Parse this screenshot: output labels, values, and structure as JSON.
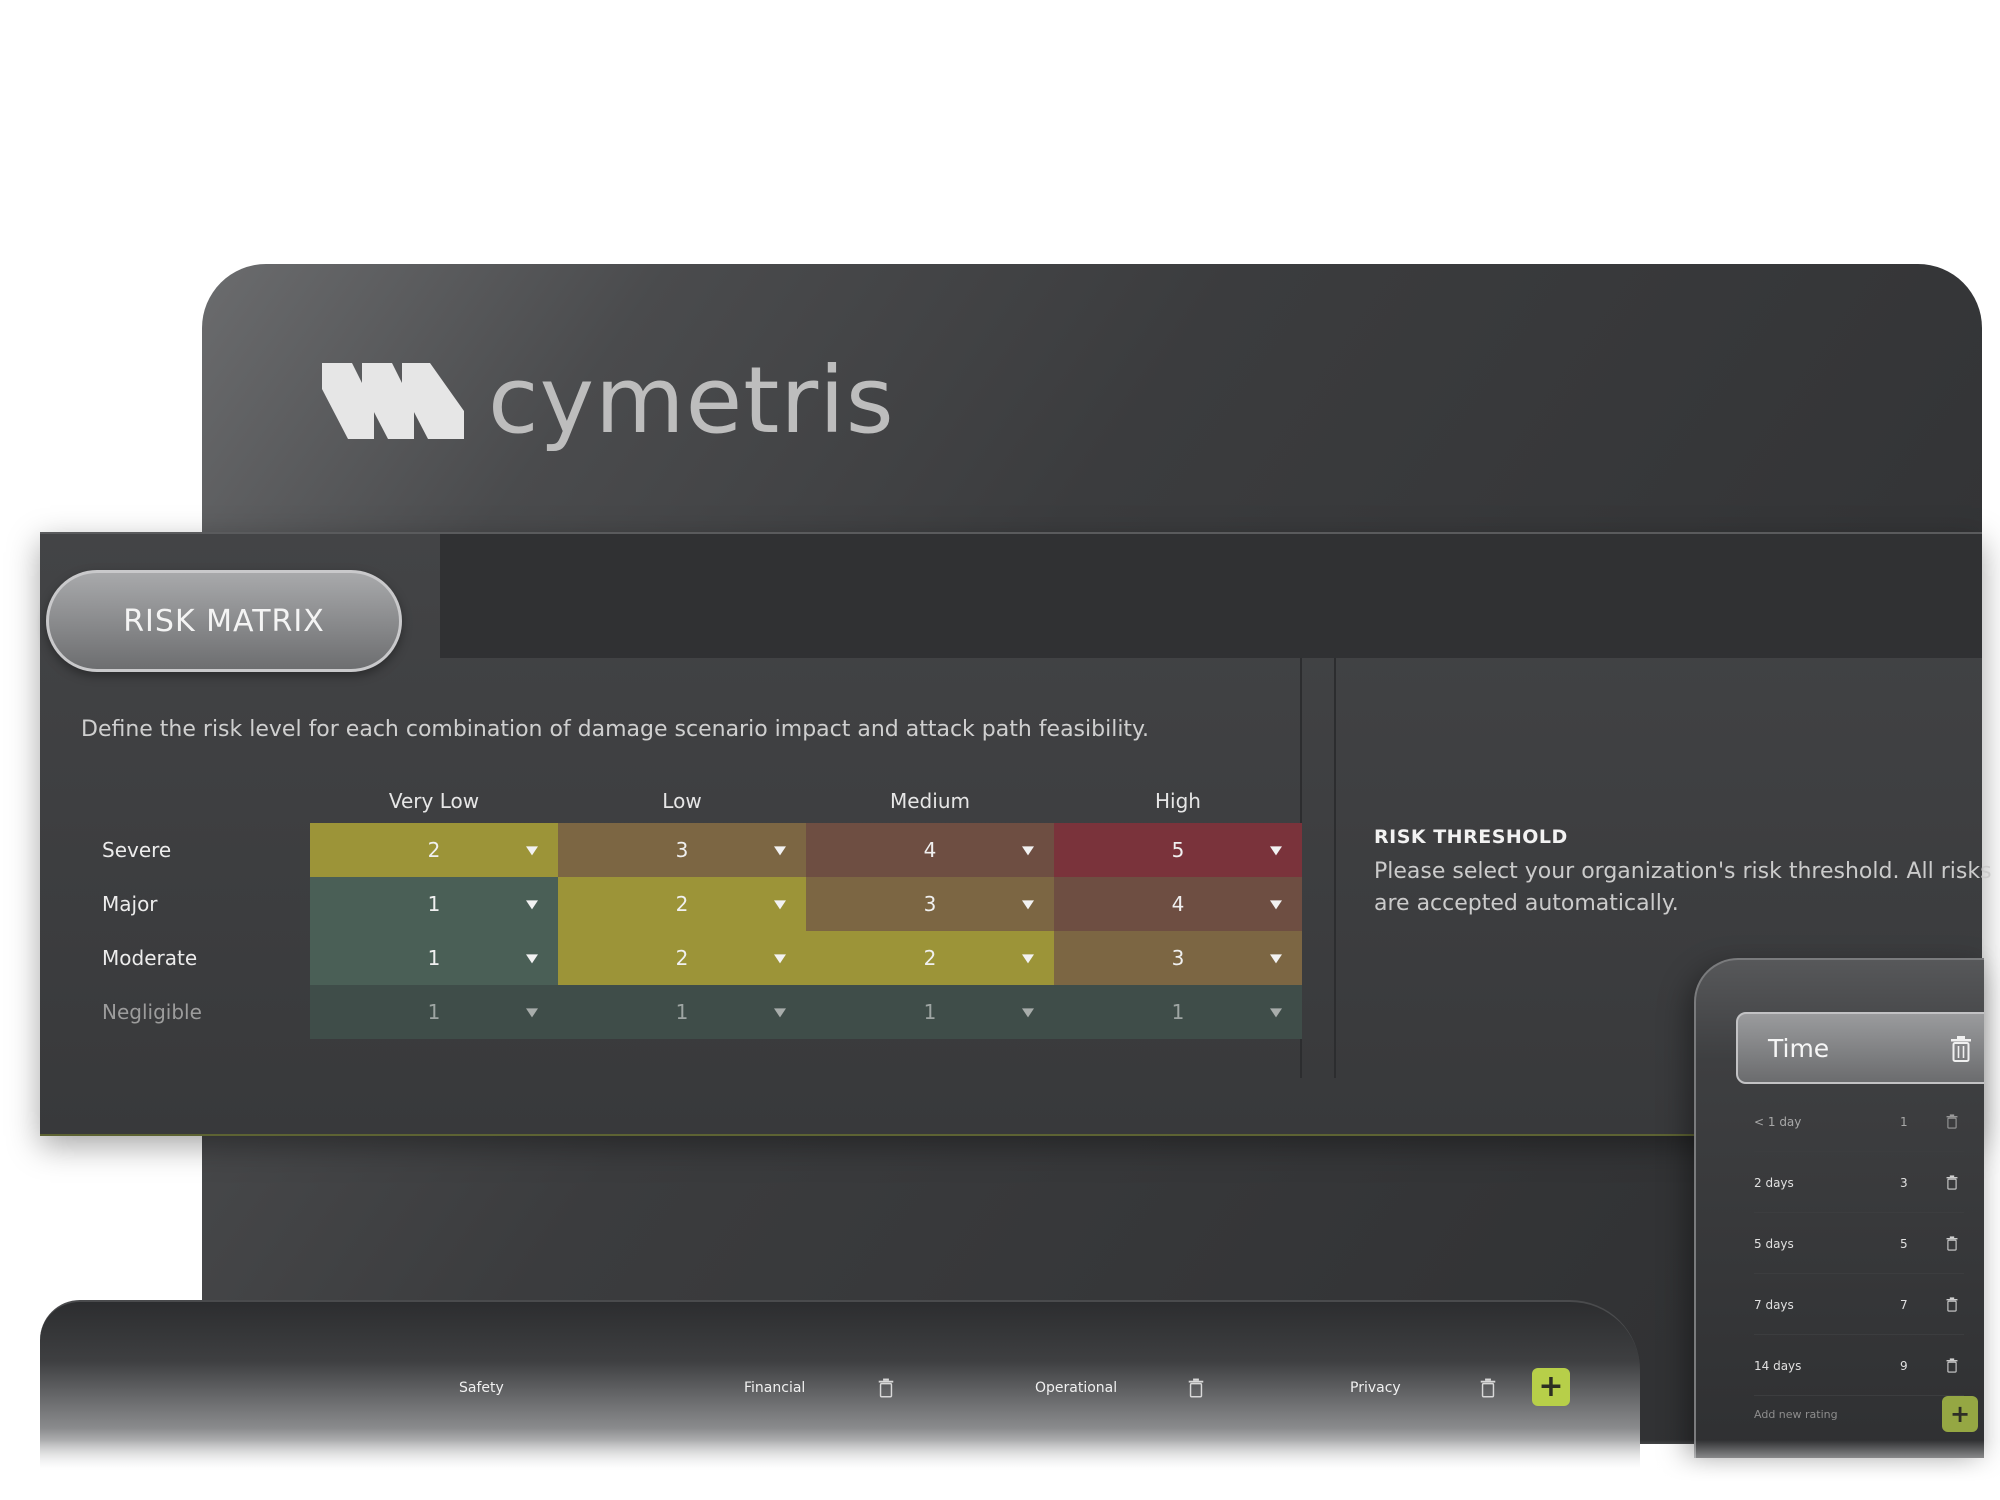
{
  "brand": {
    "name": "cymetris"
  },
  "matrix": {
    "title": "RISK MATRIX",
    "description": "Define the risk level for each combination of damage scenario impact and attack path feasibility.",
    "columns": [
      "Very Low",
      "Low",
      "Medium",
      "High"
    ],
    "rows": [
      {
        "label": "Severe",
        "values": [
          "2",
          "3",
          "4",
          "5"
        ]
      },
      {
        "label": "Major",
        "values": [
          "1",
          "2",
          "3",
          "4"
        ]
      },
      {
        "label": "Moderate",
        "values": [
          "1",
          "2",
          "2",
          "3"
        ]
      },
      {
        "label": "Negligible",
        "values": [
          "1",
          "1",
          "1",
          "1"
        ]
      }
    ],
    "level_colors": {
      "1": "#4a5f56",
      "2": "#9c9438",
      "3": "#7c6643",
      "4": "#6e4e42",
      "5": "#7a333b"
    }
  },
  "threshold": {
    "title": "RISK THRESHOLD",
    "line1": "Please select your organization's risk threshold. All risks",
    "line2": "are accepted automatically."
  },
  "time": {
    "title": "Time",
    "rows": [
      {
        "label": "< 1 day",
        "value": "1"
      },
      {
        "label": "2 days",
        "value": "3"
      },
      {
        "label": "5 days",
        "value": "5"
      },
      {
        "label": "7 days",
        "value": "7"
      },
      {
        "label": "14 days",
        "value": "9"
      }
    ],
    "add_label": "Add new rating"
  },
  "categories": {
    "items": [
      "Safety",
      "Financial",
      "Operational",
      "Privacy"
    ],
    "add_symbol": "+"
  },
  "accent_color": "#b7cf49"
}
